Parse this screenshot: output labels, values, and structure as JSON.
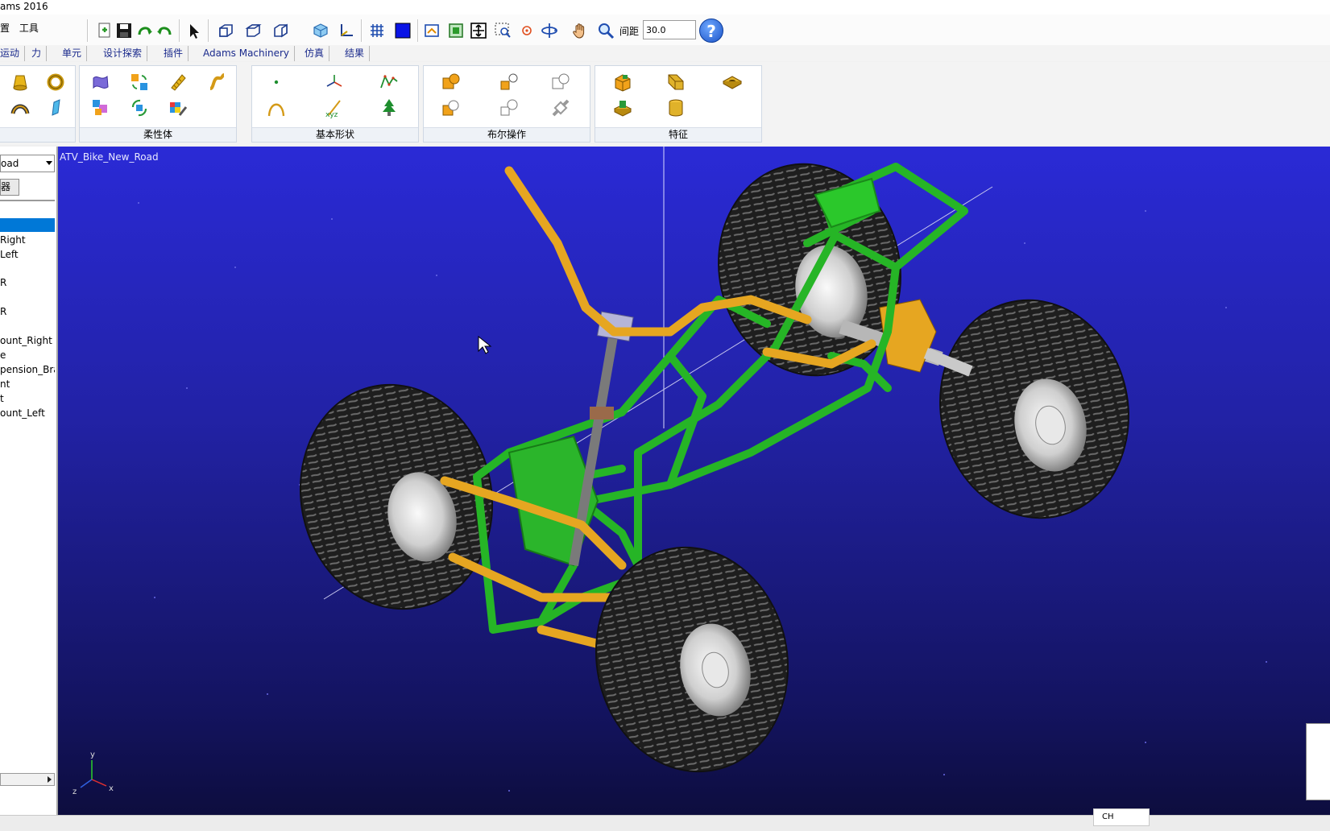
{
  "window": {
    "title": "ams 2016"
  },
  "menu": {
    "items": [
      "置",
      "工具"
    ]
  },
  "toolbar": {
    "spacing_label": "间距",
    "spacing_value": "30.0",
    "help_symbol": "?"
  },
  "ribbon_tabs": [
    "运动",
    "力",
    "单元",
    "设计探索",
    "插件",
    "Adams Machinery",
    "仿真",
    "结果"
  ],
  "ribbon_panels": {
    "solid_label": "",
    "flexible_label": "柔性体",
    "basic_shapes_label": "基本形状",
    "boolean_label": "布尔操作",
    "features_label": "特征",
    "xyz_text": "xyz"
  },
  "left_panel": {
    "model_select_value": "oad",
    "browser_tab_label": "器",
    "tree_items": [
      "Right",
      "Left",
      "R",
      "R",
      "ount_Right",
      "e",
      "pension_Bra",
      "nt",
      "t",
      "ount_Left"
    ]
  },
  "viewport": {
    "model_name": "ATV_Bike_New_Road",
    "triad": {
      "y": "y",
      "x": "x",
      "z": "z"
    }
  },
  "status": {
    "ime_text": "CH"
  },
  "colors": {
    "frame": "#2bb52b",
    "suspension": "#e6a621",
    "tire": "#2a2a2a",
    "rim": "#d8d8d8",
    "viewport_top": "#2a2ad6",
    "viewport_bottom": "#0d0d3e"
  }
}
